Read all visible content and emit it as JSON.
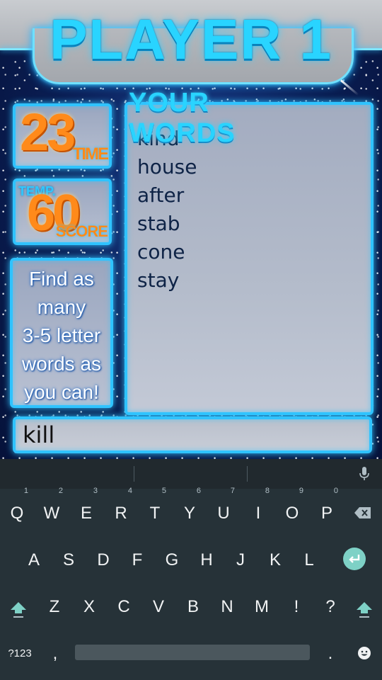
{
  "header": {
    "title": "PLAYER 1"
  },
  "stats": {
    "time_value": "23",
    "time_label": "TIME",
    "score_value": "60",
    "score_temp_label": "TEMP.",
    "score_label": "SCORE"
  },
  "instructions": {
    "lines": [
      "Find as",
      "many",
      "3-5 letter",
      "words as",
      "you can!"
    ]
  },
  "words_panel": {
    "title": "YOUR WORDS",
    "words": [
      "kind",
      "house",
      "after",
      "stab",
      "cone",
      "stay"
    ]
  },
  "input": {
    "value": "kill"
  },
  "keyboard": {
    "row1": [
      {
        "key": "Q",
        "hint": "1"
      },
      {
        "key": "W",
        "hint": "2"
      },
      {
        "key": "E",
        "hint": "3"
      },
      {
        "key": "R",
        "hint": "4"
      },
      {
        "key": "T",
        "hint": "5"
      },
      {
        "key": "Y",
        "hint": "6"
      },
      {
        "key": "U",
        "hint": "7"
      },
      {
        "key": "I",
        "hint": "8"
      },
      {
        "key": "O",
        "hint": "9"
      },
      {
        "key": "P",
        "hint": "0"
      }
    ],
    "row2": [
      "A",
      "S",
      "D",
      "F",
      "G",
      "H",
      "J",
      "K",
      "L"
    ],
    "row3": [
      "Z",
      "X",
      "C",
      "V",
      "B",
      "N",
      "M",
      "!",
      "?"
    ],
    "row4": {
      "symbols": "?123",
      "comma": ",",
      "period": "."
    },
    "icons": {
      "backspace": "backspace-icon",
      "enter": "enter-icon",
      "shift": "shift-icon",
      "mic": "mic-icon",
      "emoji": "emoji-icon"
    },
    "accent_color": "#7ed1c6"
  },
  "colors": {
    "title_cyan": "#29d4ff",
    "number_orange": "#ff8a1a",
    "panel_border": "#2fc3ff",
    "word_text": "#0e2346"
  }
}
